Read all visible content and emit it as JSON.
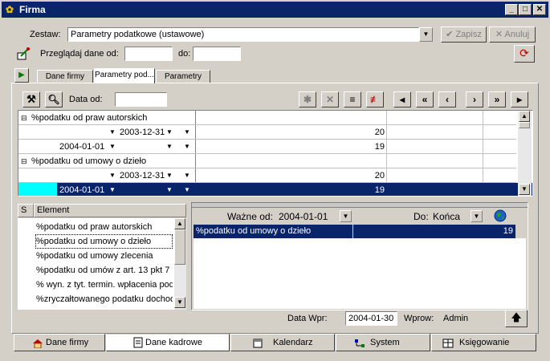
{
  "window": {
    "title": "Firma"
  },
  "header": {
    "zestaw_label": "Zestaw:",
    "zestaw_value": "Parametry podatkowe (ustawowe)",
    "save_label": "Zapisz",
    "cancel_label": "Anuluj",
    "browse_from_label": "Przeglądaj dane od:",
    "browse_from_value": "",
    "to_label": "do:",
    "to_value": ""
  },
  "tabs": [
    {
      "label": "Dane firmy"
    },
    {
      "label": "Parametry pod..."
    },
    {
      "label": "Parametry"
    }
  ],
  "toolbar": {
    "date_from_label": "Data od:",
    "date_from_value": ""
  },
  "top_grid": {
    "groups": [
      {
        "name": "%podatku od praw autorskich",
        "rows": [
          {
            "from": "",
            "to": "2003-12-31",
            "value": "20"
          },
          {
            "from": "2004-01-01",
            "to": "",
            "value": "19"
          }
        ]
      },
      {
        "name": "%podatku od umowy o dzieło",
        "rows": [
          {
            "from": "",
            "to": "2003-12-31",
            "value": "20"
          },
          {
            "from": "2004-01-01",
            "to": "",
            "value": "19"
          }
        ]
      }
    ]
  },
  "element_list": {
    "col_s": "S",
    "col_element": "Element",
    "items": [
      "%podatku od praw autorskich",
      "%podatku od umowy o dzieło",
      "%podatku od umowy zlecenia",
      "%podatku od umów z art. 13 pkt 7",
      "% wyn. z tyt. termin. wpłacenia pod.",
      "%zryczałtowanego podatku dochod"
    ],
    "selected_index": 1
  },
  "detail": {
    "valid_from_label": "Ważne od:",
    "valid_from_value": "2004-01-01",
    "to_label": "Do:",
    "to_value": "Końca",
    "row_name": "%podatku od umowy o dzieło",
    "row_value": "19"
  },
  "status": {
    "entry_date_label": "Data Wpr:",
    "entry_date_value": "2004-01-30",
    "entered_by_label": "Wprow:",
    "entered_by_value": "Admin"
  },
  "bottom_tabs": [
    {
      "label": "Dane firmy",
      "icon": "house-icon"
    },
    {
      "label": "Dane kadrowe",
      "icon": "document-icon"
    },
    {
      "label": "Kalendarz",
      "icon": "calendar-icon"
    },
    {
      "label": "System",
      "icon": "network-icon"
    },
    {
      "label": "Księgowanie",
      "icon": "ledger-icon"
    }
  ],
  "colors": {
    "title_bg": "#0a246a",
    "selection": "#0a246a",
    "marker": "#00ffff"
  }
}
